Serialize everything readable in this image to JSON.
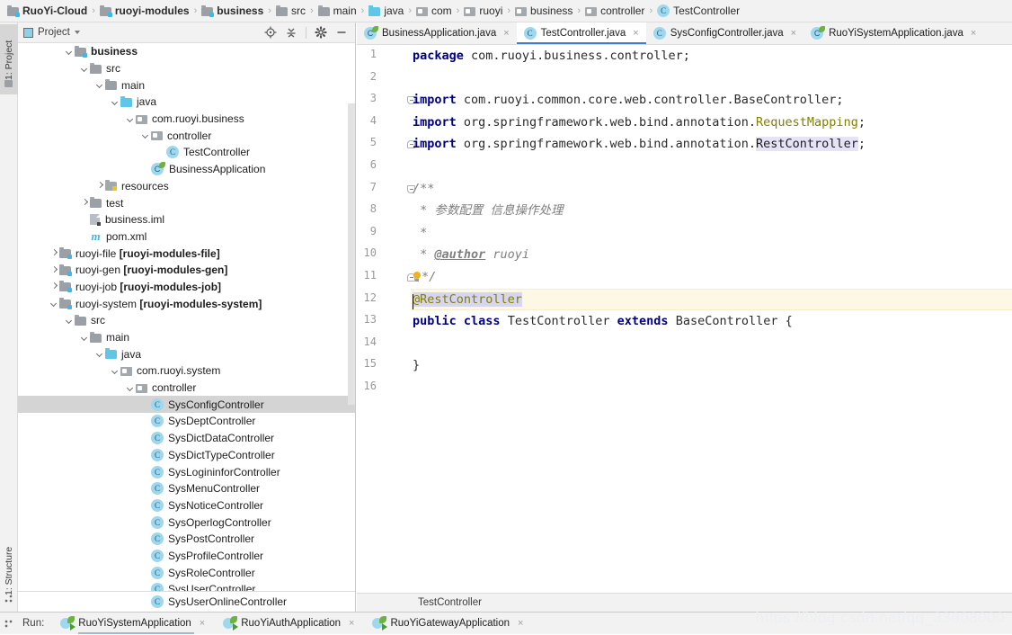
{
  "breadcrumb": [
    {
      "label": "RuoYi-Cloud",
      "icon": "module-icon",
      "bold": true
    },
    {
      "label": "ruoyi-modules",
      "icon": "module-icon",
      "bold": true
    },
    {
      "label": "business",
      "icon": "module-icon",
      "bold": true
    },
    {
      "label": "src",
      "icon": "folder-icon",
      "bold": false
    },
    {
      "label": "main",
      "icon": "folder-icon",
      "bold": false
    },
    {
      "label": "java",
      "icon": "java-folder-icon",
      "bold": false
    },
    {
      "label": "com",
      "icon": "package-icon",
      "bold": false
    },
    {
      "label": "ruoyi",
      "icon": "package-icon",
      "bold": false
    },
    {
      "label": "business",
      "icon": "package-icon",
      "bold": false
    },
    {
      "label": "controller",
      "icon": "package-icon",
      "bold": false
    },
    {
      "label": "TestController",
      "icon": "class-icon",
      "bold": false
    }
  ],
  "left_strip": {
    "project_tab": "1: Project",
    "structure_tab": "1: Structure"
  },
  "panel": {
    "title": "Project",
    "actions": [
      "locate-icon",
      "collapse-all-icon",
      "gear-icon",
      "minimize-icon"
    ],
    "bottom_crumb": {
      "label": "SysUserOnlineController",
      "icon": "class-icon"
    }
  },
  "tree": [
    {
      "indent": 2,
      "arrow": "down",
      "icon": "module-icon",
      "label": "business",
      "bold": true,
      "selected": false
    },
    {
      "indent": 3,
      "arrow": "down",
      "icon": "folder-icon",
      "label": "src",
      "bold": false,
      "selected": false
    },
    {
      "indent": 4,
      "arrow": "down",
      "icon": "folder-icon",
      "label": "main",
      "bold": false,
      "selected": false
    },
    {
      "indent": 5,
      "arrow": "down",
      "icon": "java-folder-icon",
      "label": "java",
      "bold": false,
      "selected": false
    },
    {
      "indent": 6,
      "arrow": "down",
      "icon": "package-icon",
      "label": "com.ruoyi.business",
      "bold": false,
      "selected": false
    },
    {
      "indent": 7,
      "arrow": "down",
      "icon": "package-icon",
      "label": "controller",
      "bold": false,
      "selected": false
    },
    {
      "indent": 8,
      "arrow": "none",
      "icon": "class-icon",
      "label": "TestController",
      "bold": false,
      "selected": false
    },
    {
      "indent": 7,
      "arrow": "none",
      "icon": "spring-class-icon",
      "label": "BusinessApplication",
      "bold": false,
      "selected": false
    },
    {
      "indent": 4,
      "arrow": "right",
      "icon": "resources-icon",
      "label": "resources",
      "bold": false,
      "selected": false
    },
    {
      "indent": 3,
      "arrow": "right",
      "icon": "folder-icon",
      "label": "test",
      "bold": false,
      "selected": false
    },
    {
      "indent": 3,
      "arrow": "none",
      "icon": "iml-icon",
      "label": "business.iml",
      "bold": false,
      "selected": false
    },
    {
      "indent": 3,
      "arrow": "none",
      "icon": "maven-icon",
      "label": "pom.xml",
      "bold": false,
      "selected": false
    },
    {
      "indent": 1,
      "arrow": "right",
      "icon": "module-icon",
      "label": "ruoyi-file ",
      "suffix": "[ruoyi-modules-file]",
      "bold": false,
      "selected": false
    },
    {
      "indent": 1,
      "arrow": "right",
      "icon": "module-icon",
      "label": "ruoyi-gen ",
      "suffix": "[ruoyi-modules-gen]",
      "bold": false,
      "selected": false
    },
    {
      "indent": 1,
      "arrow": "right",
      "icon": "module-icon",
      "label": "ruoyi-job ",
      "suffix": "[ruoyi-modules-job]",
      "bold": false,
      "selected": false
    },
    {
      "indent": 1,
      "arrow": "down",
      "icon": "module-icon",
      "label": "ruoyi-system ",
      "suffix": "[ruoyi-modules-system]",
      "bold": false,
      "selected": false
    },
    {
      "indent": 2,
      "arrow": "down",
      "icon": "folder-icon",
      "label": "src",
      "bold": false,
      "selected": false
    },
    {
      "indent": 3,
      "arrow": "down",
      "icon": "folder-icon",
      "label": "main",
      "bold": false,
      "selected": false
    },
    {
      "indent": 4,
      "arrow": "down",
      "icon": "java-folder-icon",
      "label": "java",
      "bold": false,
      "selected": false
    },
    {
      "indent": 5,
      "arrow": "down",
      "icon": "package-icon",
      "label": "com.ruoyi.system",
      "bold": false,
      "selected": false
    },
    {
      "indent": 6,
      "arrow": "down",
      "icon": "package-icon",
      "label": "controller",
      "bold": false,
      "selected": false
    },
    {
      "indent": 7,
      "arrow": "none",
      "icon": "class-icon",
      "label": "SysConfigController",
      "bold": false,
      "selected": true
    },
    {
      "indent": 7,
      "arrow": "none",
      "icon": "class-icon",
      "label": "SysDeptController",
      "bold": false,
      "selected": false
    },
    {
      "indent": 7,
      "arrow": "none",
      "icon": "class-icon",
      "label": "SysDictDataController",
      "bold": false,
      "selected": false
    },
    {
      "indent": 7,
      "arrow": "none",
      "icon": "class-icon",
      "label": "SysDictTypeController",
      "bold": false,
      "selected": false
    },
    {
      "indent": 7,
      "arrow": "none",
      "icon": "class-icon",
      "label": "SysLogininforController",
      "bold": false,
      "selected": false
    },
    {
      "indent": 7,
      "arrow": "none",
      "icon": "class-icon",
      "label": "SysMenuController",
      "bold": false,
      "selected": false
    },
    {
      "indent": 7,
      "arrow": "none",
      "icon": "class-icon",
      "label": "SysNoticeController",
      "bold": false,
      "selected": false
    },
    {
      "indent": 7,
      "arrow": "none",
      "icon": "class-icon",
      "label": "SysOperlogController",
      "bold": false,
      "selected": false
    },
    {
      "indent": 7,
      "arrow": "none",
      "icon": "class-icon",
      "label": "SysPostController",
      "bold": false,
      "selected": false
    },
    {
      "indent": 7,
      "arrow": "none",
      "icon": "class-icon",
      "label": "SysProfileController",
      "bold": false,
      "selected": false
    },
    {
      "indent": 7,
      "arrow": "none",
      "icon": "class-icon",
      "label": "SysRoleController",
      "bold": false,
      "selected": false
    },
    {
      "indent": 7,
      "arrow": "none",
      "icon": "class-icon",
      "label": "SysUserController",
      "bold": false,
      "selected": false
    },
    {
      "indent": 7,
      "arrow": "none",
      "icon": "class-icon",
      "label": "SysUserOnlineController",
      "bold": false,
      "selected": false
    }
  ],
  "editor": {
    "tabs": [
      {
        "label": "BusinessApplication.java",
        "icon": "spring-class-icon",
        "active": false,
        "closable": true
      },
      {
        "label": "TestController.java",
        "icon": "class-icon",
        "active": true,
        "closable": true
      },
      {
        "label": "SysConfigController.java",
        "icon": "class-icon",
        "active": false,
        "closable": true
      },
      {
        "label": "RuoYiSystemApplication.java",
        "icon": "spring-class-icon",
        "active": false,
        "closable": true
      }
    ],
    "status_text": "TestController",
    "current_line": 12,
    "lines": [
      {
        "n": 1,
        "fold": "none"
      },
      {
        "n": 2,
        "fold": "none"
      },
      {
        "n": 3,
        "fold": "start"
      },
      {
        "n": 4,
        "fold": "none"
      },
      {
        "n": 5,
        "fold": "end"
      },
      {
        "n": 6,
        "fold": "none"
      },
      {
        "n": 7,
        "fold": "start"
      },
      {
        "n": 8,
        "fold": "none"
      },
      {
        "n": 9,
        "fold": "none"
      },
      {
        "n": 10,
        "fold": "none"
      },
      {
        "n": 11,
        "fold": "end"
      },
      {
        "n": 12,
        "fold": "none"
      },
      {
        "n": 13,
        "fold": "none"
      },
      {
        "n": 14,
        "fold": "none"
      },
      {
        "n": 15,
        "fold": "none"
      },
      {
        "n": 16,
        "fold": "none"
      }
    ],
    "code": {
      "l1_kw": "package",
      "l1_rest": " com.ruoyi.business.controller;",
      "l3_kw": "import",
      "l3_rest": " com.ruoyi.common.core.web.controller.BaseController;",
      "l4_kw": "import",
      "l4_pkg": " org.springframework.web.bind.annotation.",
      "l4_cls": "RequestMapping",
      "l4_end": ";",
      "l5_kw": "import",
      "l5_pkg": " org.springframework.web.bind.annotation.",
      "l5_cls": "RestController",
      "l5_end": ";",
      "l7": "/**",
      "l8": " * 参数配置 信息操作处理",
      "l9": " *",
      "l10_pre": " * ",
      "l10_tag": "@author",
      "l10_post": " ruoyi",
      "l11": "*/",
      "l12": "@RestController",
      "l13_kw1": "public",
      "l13_kw2": "class",
      "l13_name": "TestController",
      "l13_kw3": "extends",
      "l13_super": "BaseController",
      "l13_brace": "{",
      "l15": "}"
    }
  },
  "runbar": {
    "label": "Run:",
    "tabs": [
      {
        "label": "RuoYiSystemApplication",
        "active": true,
        "closable": true
      },
      {
        "label": "RuoYiAuthApplication",
        "active": false,
        "closable": true
      },
      {
        "label": "RuoYiGatewayApplication",
        "active": false,
        "closable": true
      }
    ]
  },
  "watermark": "https://blog.csdn.net/qq_33608000"
}
